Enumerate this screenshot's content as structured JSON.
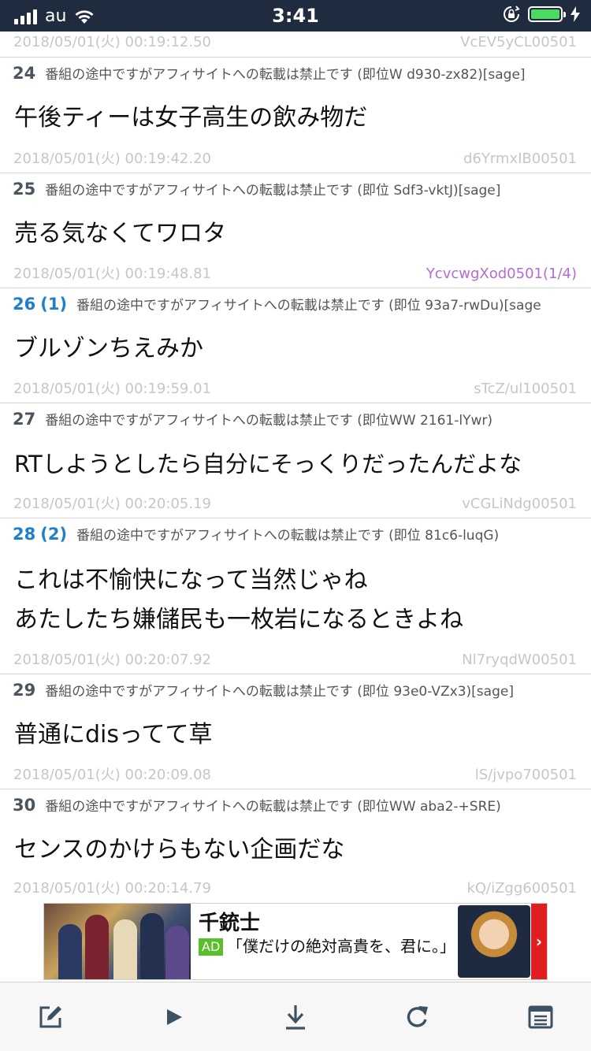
{
  "status": {
    "carrier": "au",
    "time": "3:41",
    "battery_level": 1.0,
    "battery_color": "#4cd964"
  },
  "posts": [
    {
      "date": "2018/05/01(火) 00:19:12.50",
      "id": "VcEV5yCL00501"
    },
    {
      "num": "24",
      "replies": "",
      "name": "番組の途中ですがアフィサイトへの転載は禁止です (即位W d930-zx82)[sage]",
      "lines": [
        "午後ティーは女子高生の飲み物だ"
      ],
      "date": "2018/05/01(火) 00:19:42.20",
      "id": "d6YrmxIB00501"
    },
    {
      "num": "25",
      "replies": "",
      "name": "番組の途中ですがアフィサイトへの転載は禁止です (即位 Sdf3-vktJ)[sage]",
      "lines": [
        "売る気なくてワロタ"
      ],
      "date": "2018/05/01(火) 00:19:48.81",
      "id": "YcvcwgXod0501(1/4)"
    },
    {
      "num": "26",
      "replies": "(1)",
      "name": "番組の途中ですがアフィサイトへの転載は禁止です (即位 93a7-rwDu)[sage",
      "lines": [
        "ブルゾンちえみか"
      ],
      "date": "2018/05/01(火) 00:19:59.01",
      "id": "sTcZ/ul100501"
    },
    {
      "num": "27",
      "replies": "",
      "name": "番組の途中ですがアフィサイトへの転載は禁止です (即位WW 2161-lYwr)",
      "lines": [
        "RTしようとしたら自分にそっくりだったんだよな"
      ],
      "date": "2018/05/01(火) 00:20:05.19",
      "id": "vCGLiNdg00501"
    },
    {
      "num": "28",
      "replies": "(2)",
      "name": "番組の途中ですがアフィサイトへの転載は禁止です (即位 81c6-luqG)",
      "lines": [
        "これは不愉快になって当然じゃね",
        "あたしたち嫌儲民も一枚岩になるときよね"
      ],
      "date": "2018/05/01(火) 00:20:07.92",
      "id": "Nl7ryqdW00501"
    },
    {
      "num": "29",
      "replies": "",
      "name": "番組の途中ですがアフィサイトへの転載は禁止です (即位 93e0-VZx3)[sage]",
      "lines": [
        "普通にdisってて草"
      ],
      "date": "2018/05/01(火) 00:20:09.08",
      "id": "lS/jvpo700501"
    },
    {
      "num": "30",
      "replies": "",
      "name": "番組の途中ですがアフィサイトへの転載は禁止です (即位WW aba2-+SRE)",
      "lines": [
        "センスのかけらもない企画だな"
      ],
      "date": "2018/05/01(火) 00:20:14.79",
      "id": "kQ/iZgg600501"
    }
  ],
  "ad": {
    "title": "千銃士",
    "badge": "AD",
    "text": "「僕だけの絶対高貴を、君に。」",
    "arrow": "›"
  },
  "toolbar": {
    "icons": [
      "compose-icon",
      "play-icon",
      "download-icon",
      "reload-icon",
      "menu-list-icon"
    ]
  },
  "colors": {
    "status_bar": "#1f2b3e",
    "reply_blue": "#1f7fc9",
    "id_purple": "#b56bd1",
    "toolbar_icon": "#3d5162"
  }
}
